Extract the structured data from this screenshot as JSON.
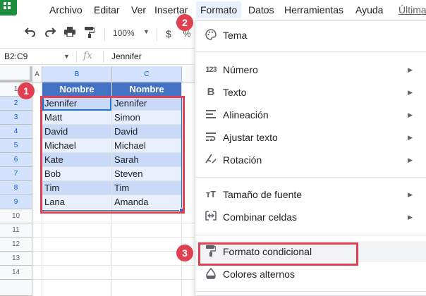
{
  "app": {
    "brand_color": "#1e8e3e",
    "accent_color": "#1a73e8",
    "highlight_color": "#e04050"
  },
  "menu": {
    "items": [
      "Archivo",
      "Editar",
      "Ver",
      "Insertar",
      "Formato",
      "Datos",
      "Herramientas",
      "Ayuda"
    ],
    "last_edit": "Última"
  },
  "toolbar": {
    "undo_icon": "undo-icon",
    "redo_icon": "redo-icon",
    "print_icon": "print-icon",
    "paint_format_icon": "paint-format-icon",
    "zoom": "100%",
    "currency": "$",
    "percent": "%"
  },
  "formula_bar": {
    "name_box": "B2:C9",
    "fx": "fx",
    "value": "Jennifer"
  },
  "sheet": {
    "columns": [
      "A",
      "B",
      "C"
    ],
    "rows": [
      "1",
      "2",
      "3",
      "4",
      "5",
      "6",
      "7",
      "8",
      "9",
      "10",
      "11",
      "12",
      "13",
      "14"
    ],
    "header": [
      "Nombre",
      "Nombre"
    ],
    "data": [
      [
        "Jennifer",
        "Jennifer"
      ],
      [
        "Matt",
        "Simon"
      ],
      [
        "David",
        "David"
      ],
      [
        "Michael",
        "Michael"
      ],
      [
        "Kate",
        "Sarah"
      ],
      [
        "Bob",
        "Steven"
      ],
      [
        "Tim",
        "Tim"
      ],
      [
        "Lana",
        "Amanda"
      ]
    ]
  },
  "format_menu": {
    "items": [
      {
        "icon": "palette-icon",
        "label": "Tema",
        "submenu": false
      },
      {
        "icon": "number-format-icon",
        "label": "Número",
        "submenu": true
      },
      {
        "icon": "bold-icon",
        "label": "Texto",
        "submenu": true
      },
      {
        "icon": "align-icon",
        "label": "Alineación",
        "submenu": true
      },
      {
        "icon": "wrap-text-icon",
        "label": "Ajustar texto",
        "submenu": true
      },
      {
        "icon": "rotation-icon",
        "label": "Rotación",
        "submenu": true
      },
      {
        "icon": "font-size-icon",
        "label": "Tamaño de fuente",
        "submenu": true
      },
      {
        "icon": "merge-cells-icon",
        "label": "Combinar celdas",
        "submenu": true
      },
      {
        "icon": "paint-roller-icon",
        "label": "Formato condicional",
        "submenu": false
      },
      {
        "icon": "alternating-colors-icon",
        "label": "Colores alternos",
        "submenu": false
      }
    ]
  },
  "badges": [
    "1",
    "2",
    "3"
  ]
}
